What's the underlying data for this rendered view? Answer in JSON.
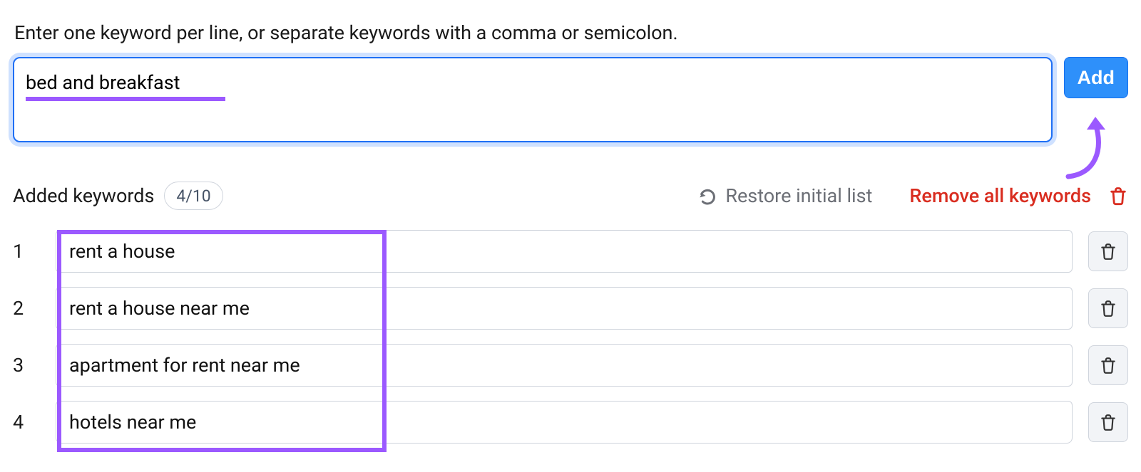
{
  "instruction": "Enter one keyword per line, or separate keywords with a comma or semicolon.",
  "textbox": {
    "value": "bed and breakfast"
  },
  "add_button_label": "Add",
  "added": {
    "label": "Added keywords",
    "count": "4/10"
  },
  "restore_label": "Restore initial list",
  "remove_all_label": "Remove all keywords",
  "keywords": [
    {
      "index": "1",
      "text": "rent a house"
    },
    {
      "index": "2",
      "text": "rent a house near me"
    },
    {
      "index": "3",
      "text": "apartment for rent near me"
    },
    {
      "index": "4",
      "text": "hotels near me"
    }
  ],
  "colors": {
    "accent_purple": "#9b59ff",
    "danger_red": "#d92d20",
    "primary_blue": "#2e90fa",
    "focus_blue": "#1e6ff5"
  }
}
